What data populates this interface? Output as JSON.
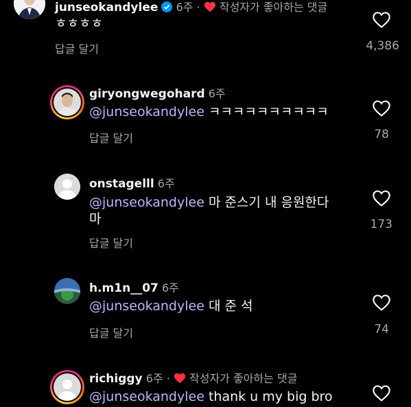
{
  "comments": [
    {
      "username": "junseokandylee",
      "time": "6주",
      "separator": "·",
      "author_liked": "작성자가 좋아하는 댓글",
      "mention": "",
      "text": "ㅎㅎㅎㅎ",
      "reply_label": "답글 달기",
      "likes": "4,386"
    },
    {
      "username": "giryongwegohard",
      "time": "6주",
      "mention": "@junseokandylee",
      "text": "ㅋㅋㅋㅋㅋㅋㅋㅋㅋㅋ",
      "reply_label": "답글 달기",
      "likes": "78"
    },
    {
      "username": "onstagelll",
      "time": "6주",
      "mention": "@junseokandylee",
      "text": "마 준스기 내 응원한다",
      "text_line2": "마",
      "reply_label": "답글 달기",
      "likes": "173"
    },
    {
      "username": "h.m1n__07",
      "time": "6주",
      "mention": "@junseokandylee",
      "text": "대 준 석",
      "reply_label": "답글 달기",
      "likes": "74"
    },
    {
      "username": "richiggy",
      "time": "6주",
      "separator": "·",
      "author_liked": "작성자가 좋아하는 댓글",
      "mention": "@junseokandylee",
      "text": "thank u my big bro"
    }
  ],
  "colors": {
    "background": "#000000",
    "mention": "#b9b8ff",
    "muted": "#a8a8a8",
    "like_red": "#ff3040",
    "verified": "#0095f6"
  }
}
